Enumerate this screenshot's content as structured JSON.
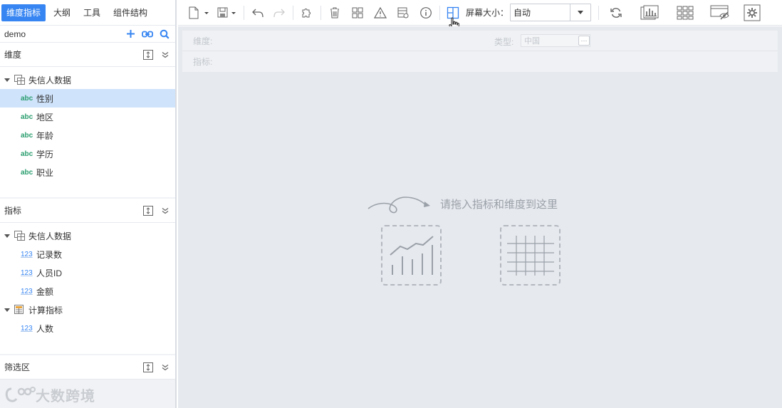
{
  "left_panel": {
    "tabs": [
      {
        "label": "维度指标",
        "active": true
      },
      {
        "label": "大纲",
        "active": false
      },
      {
        "label": "工具",
        "active": false
      },
      {
        "label": "组件结构",
        "active": false
      }
    ],
    "package_name": "demo",
    "dimension_section": {
      "title": "维度",
      "group": "失信人数据",
      "items": [
        {
          "type": "abc",
          "label": "性别",
          "selected": true
        },
        {
          "type": "abc",
          "label": "地区",
          "selected": false
        },
        {
          "type": "abc",
          "label": "年龄",
          "selected": false
        },
        {
          "type": "abc",
          "label": "学历",
          "selected": false
        },
        {
          "type": "abc",
          "label": "职业",
          "selected": false
        }
      ]
    },
    "measure_section": {
      "title": "指标",
      "groups": [
        {
          "label": "失信人数据",
          "items": [
            {
              "type": "123",
              "label": "记录数"
            },
            {
              "type": "123",
              "label": "人员ID"
            },
            {
              "type": "123",
              "label": "金额"
            }
          ]
        },
        {
          "label": "计算指标",
          "items": [
            {
              "type": "123",
              "label": "人数"
            }
          ]
        }
      ]
    },
    "filter_section": {
      "title": "筛选区"
    },
    "watermark": "大数跨境"
  },
  "toolbar": {
    "screen_size_label": "屏幕大小：",
    "screen_size_value": "自动"
  },
  "main": {
    "filter": {
      "dimension_label": "维度:",
      "type_label": "类型:",
      "type_value": "中国",
      "type_more": "···",
      "measure_label": "指标:"
    },
    "drop_hint": "请拖入指标和维度到这里"
  },
  "colors": {
    "accent": "#3685f2",
    "selected_row": "#cfe3fb",
    "dimension_type": "#2b9e6f",
    "measure_type": "#3685f2"
  }
}
